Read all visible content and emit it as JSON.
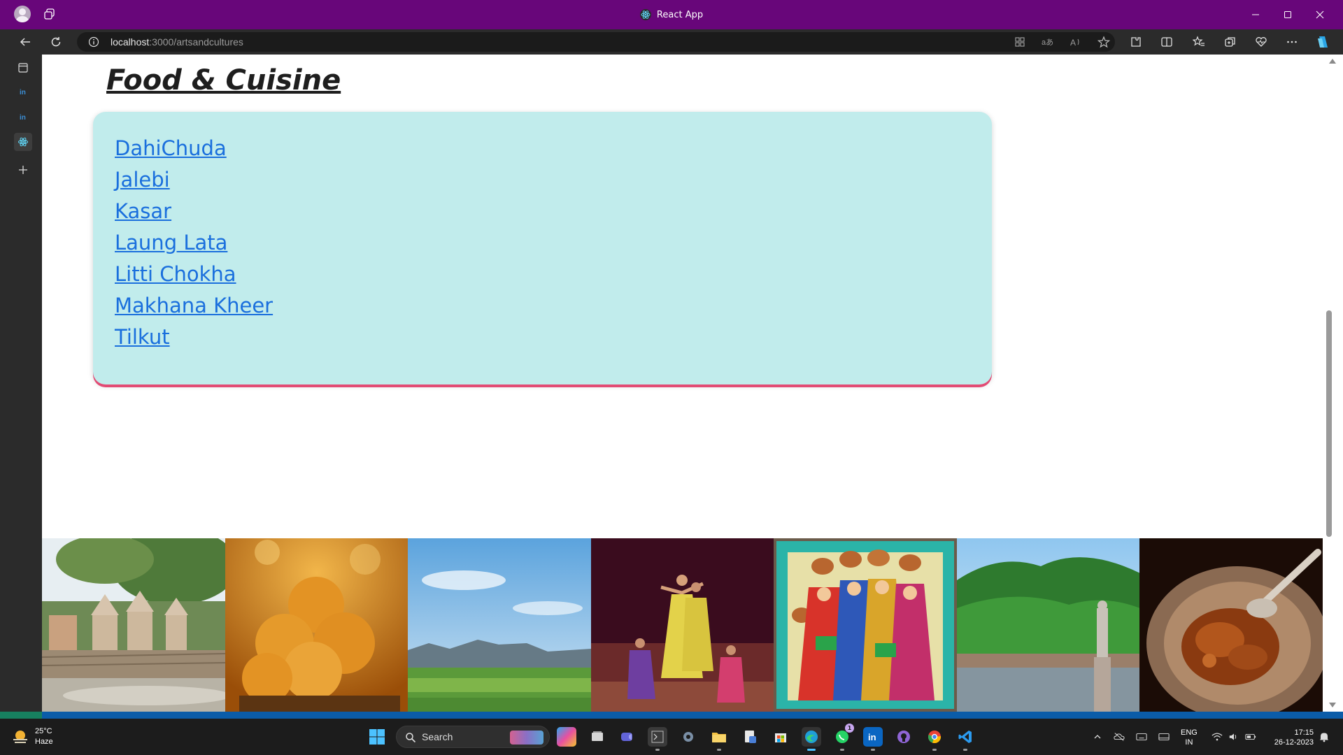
{
  "window": {
    "title": "React App",
    "title_bar_color": "#68067a"
  },
  "toolbar": {
    "url_host": "localhost",
    "url_path": ":3000/artsandcultures",
    "icons": [
      "back-icon",
      "refresh-icon",
      "app-available-icon",
      "translate-icon",
      "read-aloud-icon",
      "favorite-star-icon",
      "extensions-icon",
      "split-screen-icon",
      "favorites-icon",
      "collections-icon",
      "performance-icon",
      "more-icon",
      "copilot-icon"
    ]
  },
  "sidebar": {
    "tabs": [
      "workspace-tab-icon",
      "linkedin-tab-icon",
      "linkedin-tab-icon",
      "react-tab-icon",
      "new-tab-icon"
    ]
  },
  "page": {
    "heading": "Food & Cuisine",
    "card_color": "#c1ecec",
    "card_shadow_color": "#e24b74",
    "link_color": "#1a6fdd",
    "foods": [
      "DahiChuda",
      "Jalebi",
      "Kasar",
      "Laung Lata",
      "Litti Chokha",
      "Makhana Kheer",
      "Tilkut"
    ],
    "gallery": [
      "ghat-temple-image",
      "laddoo-sweets-image",
      "green-valley-image",
      "dancers-stage-image",
      "madhubani-painting-image",
      "lake-statue-image",
      "curry-bowl-image"
    ]
  },
  "taskbar": {
    "weather_temp": "25°C",
    "weather_cond": "Haze",
    "search_label": "Search",
    "lang_line1": "ENG",
    "lang_line2": "IN",
    "time": "17:15",
    "date": "26-12-2023",
    "whatsapp_badge": "1",
    "accent": "#4cc2ff"
  }
}
